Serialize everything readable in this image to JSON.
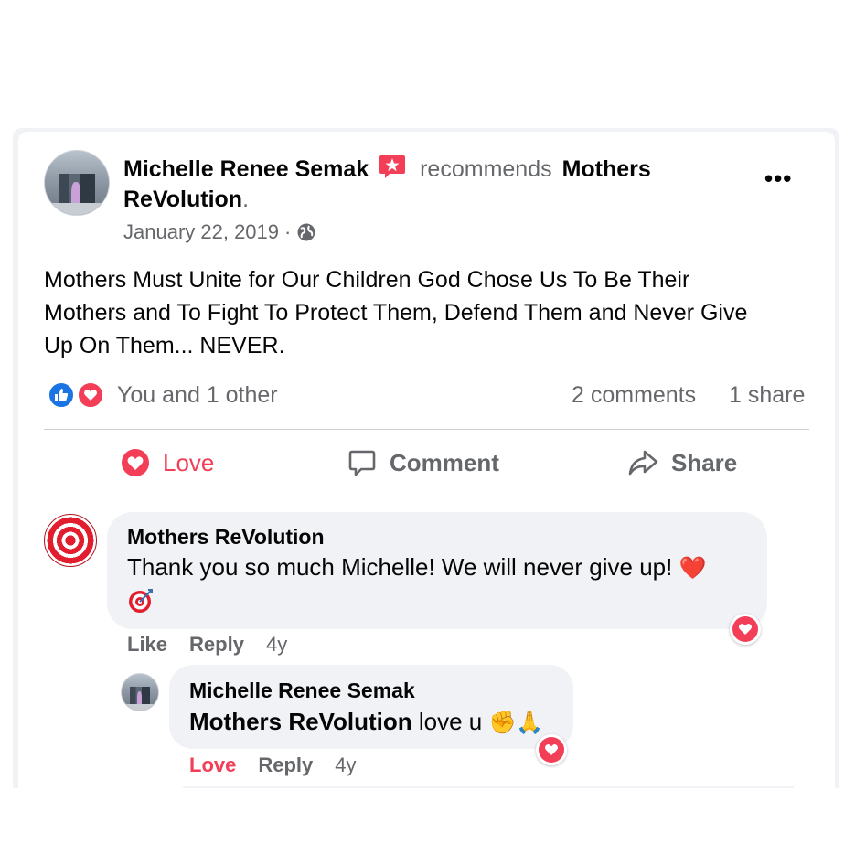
{
  "post": {
    "author": "Michelle Renee Semak",
    "verb": "recommends",
    "page_line1": "Mothers",
    "page_line2": "ReVolution",
    "period": ".",
    "date": "January 22, 2019",
    "date_sep": "·",
    "body": "Mothers Must Unite for Our Children God Chose Us To Be Their Mothers and To Fight To Protect Them, Defend Them and Never Give Up On Them... NEVER.",
    "more_icon": "•••"
  },
  "reactions": {
    "summary": "You and 1 other",
    "comments": "2 comments",
    "shares": "1 share"
  },
  "actions": {
    "love": "Love",
    "comment": "Comment",
    "share": "Share",
    "love_color": "#f33e58"
  },
  "comments": [
    {
      "author": "Mothers ReVolution",
      "text": "Thank you so much Michelle! We will never give up!",
      "emoji_heart": "❤️",
      "emoji_target": "🎯",
      "like": "Like",
      "reply": "Reply",
      "time": "4y"
    }
  ],
  "reply": {
    "author": "Michelle Renee Semak",
    "mention": "Mothers ReVolution",
    "text": " love u ",
    "emoji_fist": "✊",
    "emoji_pray": "🙏",
    "love": "Love",
    "reply": "Reply",
    "time": "4y"
  }
}
